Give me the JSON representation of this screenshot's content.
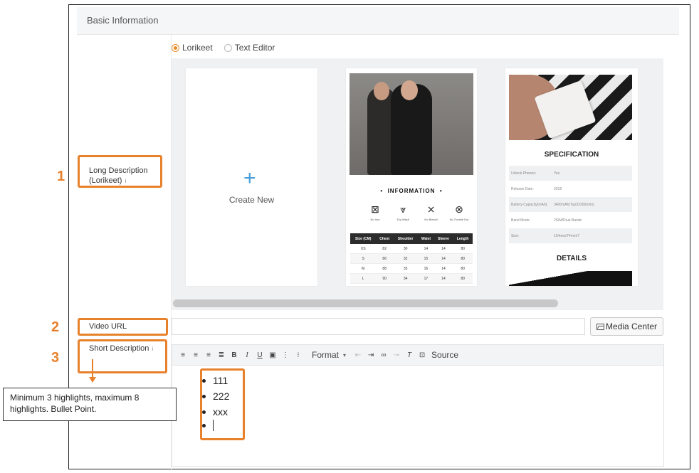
{
  "section": {
    "title": "Basic Information"
  },
  "editor_mode": {
    "options": [
      {
        "label": "Lorikeet",
        "selected": true
      },
      {
        "label": "Text Editor",
        "selected": false
      }
    ]
  },
  "gallery": {
    "create_new": "Create New",
    "fashion_template": {
      "heading": "INFORMATION",
      "care": [
        "No Iron",
        "Dry Wash",
        "No Bleach",
        "No Tumble Dry"
      ],
      "size_table": {
        "headers": [
          "Size (CM)",
          "Chest",
          "Shoulder",
          "Waist",
          "Sleeve",
          "Length"
        ],
        "rows": [
          [
            "XS",
            "82",
            "30",
            "14",
            "14",
            "80"
          ],
          [
            "S",
            "86",
            "32",
            "15",
            "14",
            "80"
          ],
          [
            "M",
            "88",
            "33",
            "16",
            "14",
            "80"
          ],
          [
            "L",
            "90",
            "34",
            "17",
            "14",
            "80"
          ]
        ]
      }
    },
    "spec_template": {
      "heading": "SPECIFICATION",
      "rows": [
        {
          "key": "Unlock Phones:",
          "value": "Yes"
        },
        {
          "key": "Release Date:",
          "value": "2018"
        },
        {
          "key": "Battery Capacity(mAh):",
          "value": "3400mAh(Typ)/3300(min)"
        },
        {
          "key": "Band Mode:",
          "value": "2SIM/Dual-Bands"
        },
        {
          "key": "Size:",
          "value": "154mm/74mm/7"
        }
      ],
      "details_heading": "DETAILS"
    }
  },
  "fields": {
    "long_description": {
      "line1": "Long Description",
      "line2": "(Lorikeet)",
      "info": "i"
    },
    "video_url": {
      "label": "Video URL",
      "value": ""
    },
    "short_description": {
      "label": "Short Description",
      "info": "i"
    }
  },
  "media_center_button": "Media Center",
  "toolbar": {
    "format_label": "Format",
    "source_label": "Source",
    "icons": [
      "align-left-icon",
      "align-center-icon",
      "align-right-icon",
      "align-justify-icon",
      "bold-icon",
      "italic-icon",
      "underline-icon",
      "image-icon",
      "numbered-list-icon",
      "bulleted-list-icon",
      "outdent-icon",
      "indent-icon",
      "link-icon",
      "unlink-icon",
      "clear-format-icon",
      "source-icon"
    ]
  },
  "short_description_content": {
    "bullets": [
      "111",
      "222",
      "xxx",
      ""
    ]
  },
  "annotations": {
    "numbers": [
      "1",
      "2",
      "3"
    ],
    "note": "Minimum 3 highlights, maximum 8 highlights. Bullet Point.",
    "accent_color": "#e8812c"
  }
}
